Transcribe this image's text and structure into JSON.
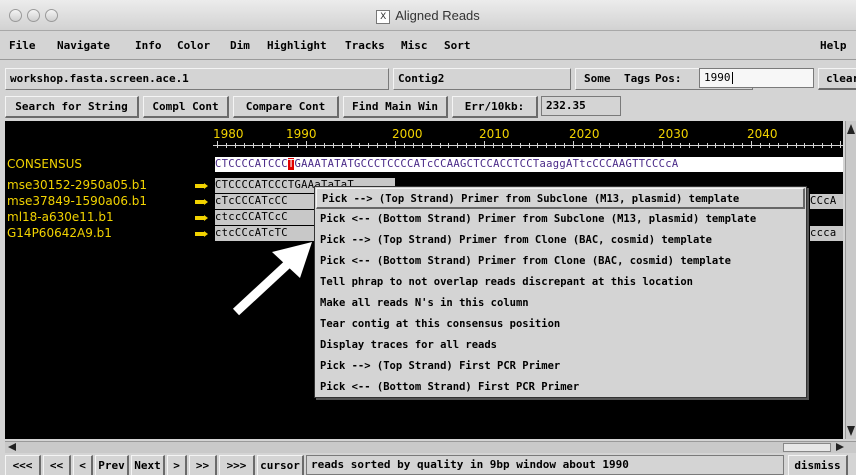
{
  "window": {
    "title": "Aligned Reads",
    "app_icon": "x11-icon"
  },
  "menu": [
    "File",
    "Navigate",
    "Info",
    "Color",
    "Dim",
    "Highlight",
    "Tracks",
    "Misc",
    "Sort"
  ],
  "help": "Help",
  "toolbar1": {
    "filename": "workshop.fasta.screen.ace.1",
    "contig": "Contig2",
    "some_label": "Some",
    "tags_label": "Tags",
    "pos_label": "Pos:",
    "pos_value": "1990",
    "clear_label": "clear"
  },
  "toolbar2": {
    "search": "Search for String",
    "compl": "Compl Cont",
    "compare": "Compare Cont",
    "find_main": "Find Main Win",
    "err_label": "Err/10kb:",
    "err_value": "232.35"
  },
  "ruler": [
    "1980",
    "1990",
    "2000",
    "2010",
    "2020",
    "2030",
    "2040"
  ],
  "consensus": {
    "label": "CONSENSUS",
    "seq_a": "CTCCCCATCCC",
    "seq_hl": "T",
    "seq_b": "GAAATATATGCCCTCCCCATcCCAAGCTCCACCTCCTaaggATtcCCCAAGTTCCCcA"
  },
  "reads": [
    {
      "name": "mse30152-2950a05.b1",
      "seq": "CTCCCCATCCCTGAAaTaTaT",
      "tail": ""
    },
    {
      "name": "mse37849-1590a06.b1",
      "seq": "cTcCCCATcCC",
      "tail": "CCcA"
    },
    {
      "name": "ml18-a630e11.b1",
      "seq": "ctccCCATCcC",
      "tail": ""
    },
    {
      "name": "G14P60642A9.b1",
      "seq": "ctcCCcATcTC",
      "tail": "ccca"
    }
  ],
  "popup": {
    "items": [
      "Pick --> (Top Strand) Primer from Subclone (M13, plasmid) template",
      "Pick <-- (Bottom Strand) Primer from Subclone (M13, plasmid) template",
      "Pick --> (Top Strand) Primer from Clone (BAC, cosmid) template",
      "Pick <-- (Bottom Strand) Primer from Clone (BAC, cosmid) template",
      "Tell phrap to not overlap reads discrepant at this location",
      "Make all reads N's in this column",
      "Tear contig at this consensus position",
      "Display traces for all reads",
      "Pick --> (Top Strand) First PCR Primer",
      "Pick <-- (Bottom Strand) First PCR Primer"
    ]
  },
  "nav": {
    "b1": "<<<",
    "b2": "<<",
    "b3": "<",
    "prev": "Prev",
    "next": "Next",
    "b4": ">",
    "b5": ">>",
    "b6": ">>>",
    "cursor": "cursor",
    "status": "reads sorted by quality in 9bp window about 1990",
    "dismiss": "dismiss"
  },
  "colors": {
    "ruler": "#f2d300",
    "highlight": "#e10000",
    "consensus_text": "#4a2a88"
  }
}
